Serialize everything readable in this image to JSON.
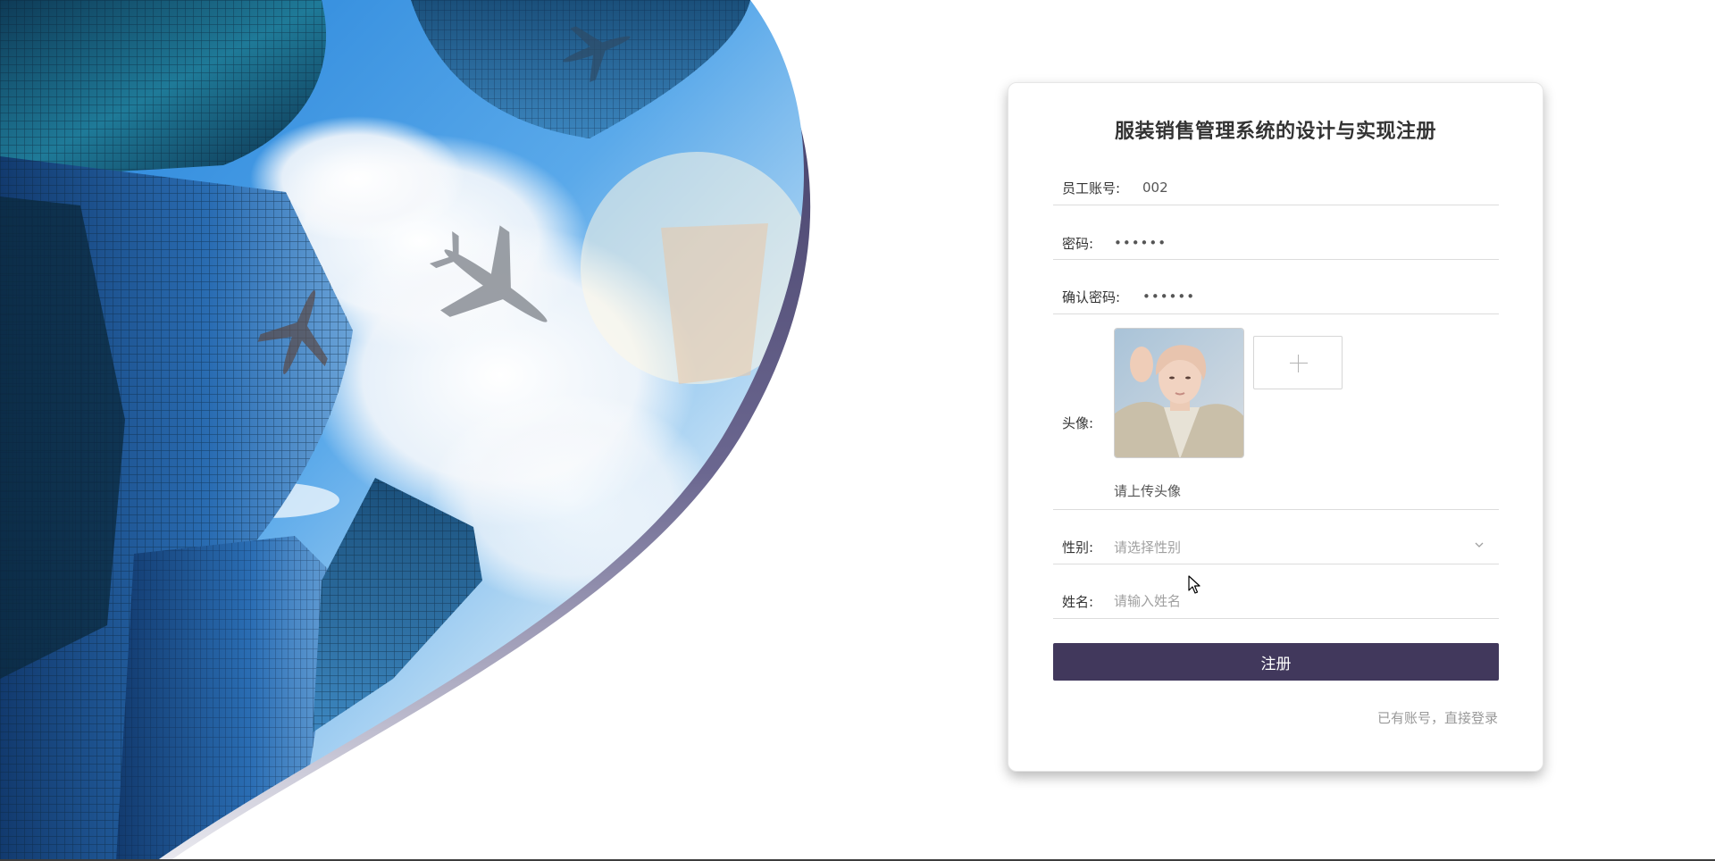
{
  "register": {
    "title": "服装销售管理系统的设计与实现注册",
    "account": {
      "label": "员工账号:",
      "value": "002"
    },
    "password": {
      "label": "密码:",
      "value": "••••••"
    },
    "confirm_password": {
      "label": "确认密码:",
      "value": "••••••"
    },
    "avatar": {
      "label": "头像:",
      "tip": "请上传头像",
      "upload_icon": "plus-icon"
    },
    "gender": {
      "label": "性别:",
      "placeholder": "请选择性别",
      "icon": "chevron-down-icon"
    },
    "name": {
      "label": "姓名:",
      "placeholder": "请输入姓名"
    },
    "submit_label": "注册",
    "login_link": "已有账号，直接登录"
  },
  "colors": {
    "primary_button": "#41385c",
    "hero_border": "#3f3a63",
    "link": "#999999"
  }
}
